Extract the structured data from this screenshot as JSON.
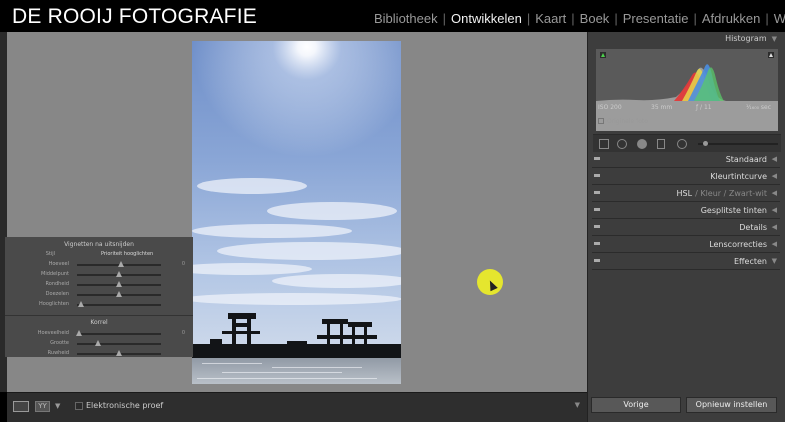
{
  "brand": "DE ROOIJ FOTOGRAFIE",
  "modules": [
    {
      "label": "Bibliotheek",
      "active": false
    },
    {
      "label": "Ontwikkelen",
      "active": true
    },
    {
      "label": "Kaart",
      "active": false
    },
    {
      "label": "Boek",
      "active": false
    },
    {
      "label": "Presentatie",
      "active": false
    },
    {
      "label": "Afdrukken",
      "active": false
    },
    {
      "label": "Web",
      "active": false
    }
  ],
  "toolbar": {
    "view_grid_label": "YY",
    "proof_label": "Elektronische proef"
  },
  "histogram": {
    "title": "Histogram",
    "iso": "ISO 200",
    "focal": "35 mm",
    "aperture": "ƒ / 11",
    "shutter": "¹⁄₁₆₀₀ sec",
    "original_label": "Originele foto"
  },
  "sections": [
    {
      "label": "Standaard"
    },
    {
      "label": "Kleurtintcurve"
    },
    {
      "label": "HSL",
      "extra": "/ Kleur / Zwart-wit"
    },
    {
      "label": "Gesplitste tinten"
    },
    {
      "label": "Details"
    },
    {
      "label": "Lenscorrecties"
    },
    {
      "label": "Effecten"
    }
  ],
  "effects": {
    "vignette_title": "Vignetten na uitsnijden",
    "style_label": "Stijl",
    "style_value": "Prioriteit hooglichten",
    "vignette_rows": [
      {
        "label": "Hoeveel",
        "position": 0.52,
        "value": "0"
      },
      {
        "label": "Middelpunt",
        "position": 0.5,
        "value": ""
      },
      {
        "label": "Rondheid",
        "position": 0.5,
        "value": ""
      },
      {
        "label": "Doezelen",
        "position": 0.5,
        "value": ""
      },
      {
        "label": "Hooglichten",
        "position": 0.05,
        "value": ""
      }
    ],
    "grain_title": "Korrel",
    "grain_rows": [
      {
        "label": "Hoeveelheid",
        "position": 0.02,
        "value": "0"
      },
      {
        "label": "Grootte",
        "position": 0.25,
        "value": ""
      },
      {
        "label": "Ruwheid",
        "position": 0.5,
        "value": ""
      }
    ]
  },
  "buttons": {
    "previous": "Vorige",
    "reset": "Opnieuw instellen"
  },
  "colors": {
    "accent_halo": "#e5e62e",
    "panel_bg": "#3d3d3d",
    "canvas_bg": "#878787"
  }
}
